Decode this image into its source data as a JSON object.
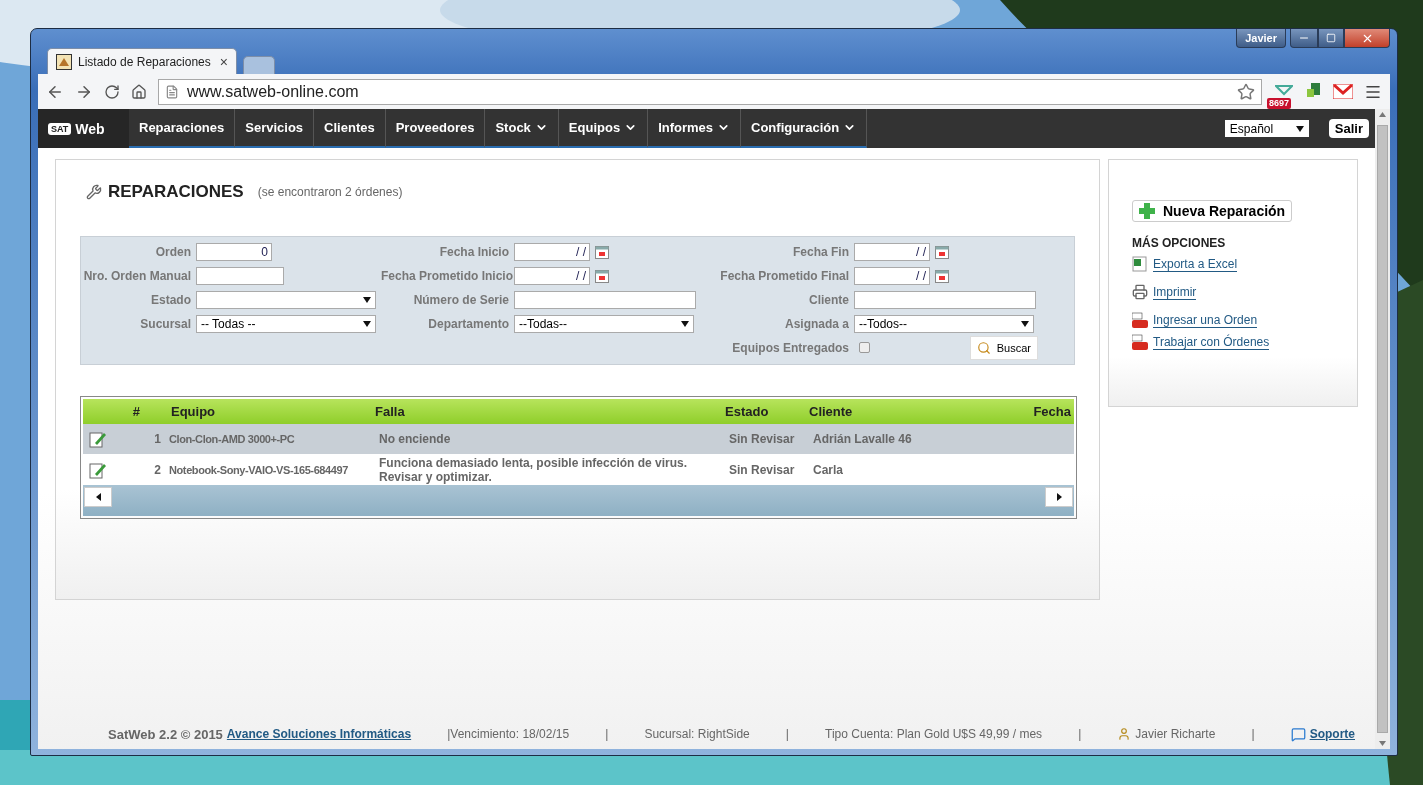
{
  "browser": {
    "tabs": [
      {
        "title": "Listado de Reparaciones",
        "close": "×",
        "selected": true
      },
      {
        "selected": false
      }
    ],
    "profile": "Javier",
    "url": "www.satweb-online.com",
    "extension_badge": "8697"
  },
  "nav": {
    "logo_badge": "SAT",
    "logo_text": "Web",
    "items": [
      {
        "label": "Reparaciones",
        "dropdown": false
      },
      {
        "label": "Servicios",
        "dropdown": false
      },
      {
        "label": "Clientes",
        "dropdown": false
      },
      {
        "label": "Proveedores",
        "dropdown": false
      },
      {
        "label": "Stock",
        "dropdown": true
      },
      {
        "label": "Equipos",
        "dropdown": true
      },
      {
        "label": "Informes",
        "dropdown": true
      },
      {
        "label": "Configuración",
        "dropdown": true
      }
    ],
    "language": "Español",
    "logout": "Salir"
  },
  "page": {
    "title": "REPARACIONES",
    "subtitle": "(se encontraron 2 órdenes)"
  },
  "filters": {
    "columns": [
      [
        {
          "label": "Orden",
          "kind": "number",
          "value": "0"
        },
        {
          "label": "Nro. Orden Manual",
          "kind": "short"
        },
        {
          "label": "Estado",
          "kind": "select"
        },
        {
          "label": "Sucursal",
          "kind": "select",
          "value": "-- Todas --"
        }
      ],
      [
        {
          "label": "Fecha Inicio",
          "kind": "date",
          "value": "/ /"
        },
        {
          "label": "Fecha Prometido Inicio",
          "kind": "date",
          "value": "/ /"
        },
        {
          "label": "Número de Serie",
          "kind": "text"
        },
        {
          "label": "Departamento",
          "kind": "select",
          "value": "--Todas--"
        }
      ],
      [
        {
          "label": "Fecha Fin",
          "kind": "date",
          "value": "/ /"
        },
        {
          "label": "Fecha Prometido Final",
          "kind": "date",
          "value": "/ /"
        },
        {
          "label": "Cliente",
          "kind": "text"
        },
        {
          "label": "Asignada a",
          "kind": "select",
          "value": "--Todos--"
        },
        {
          "label": "Equipos Entregados",
          "kind": "checkbox",
          "checked": false
        }
      ]
    ],
    "search_button": "Buscar"
  },
  "table": {
    "columns": [
      "#",
      "Equipo",
      "Falla",
      "Estado",
      "Cliente",
      "Fecha"
    ],
    "rows": [
      {
        "number": "1",
        "equipo": "Clon-Clon-AMD 3000+-PC",
        "falla": "No enciende",
        "estado": "Sin Revisar",
        "cliente": "Adrián Lavalle 46",
        "selected": true
      },
      {
        "number": "2",
        "equipo": "Notebook-Sony-VAIO-VS-165-684497",
        "falla": "Funciona demasiado lenta, posible infección de virus. Revisar y optimizar.",
        "estado": "Sin Revisar",
        "cliente": "Carla",
        "selected": false
      }
    ]
  },
  "sidebar": {
    "new_button": "Nueva Reparación",
    "options_title": "MÁS OPCIONES",
    "links": [
      {
        "label": "Exporta a Excel",
        "kind": "sheet"
      },
      {
        "label": "Imprimir",
        "kind": "printer"
      },
      {
        "label": "Ingresar una Orden",
        "kind": "video"
      },
      {
        "label": "Trabajar con Órdenes",
        "kind": "video"
      }
    ]
  },
  "footer": [
    {
      "kind": "brand",
      "text": "SatWeb 2.2 © 2015"
    },
    {
      "kind": "link",
      "text": "Avance Soluciones Informáticas"
    },
    {
      "kind": "text",
      "text": "|Vencimiento: 18/02/15"
    },
    {
      "kind": "separator",
      "text": "|"
    },
    {
      "kind": "text",
      "text": "Sucursal: RightSide"
    },
    {
      "kind": "separator",
      "text": "|"
    },
    {
      "kind": "text",
      "text": "Tipo Cuenta: Plan Gold U$S 49,99 / mes"
    },
    {
      "kind": "separator",
      "text": "|"
    },
    {
      "kind": "user",
      "text": "Javier Richarte"
    },
    {
      "kind": "separator",
      "text": "|"
    },
    {
      "kind": "support",
      "text": "Soporte"
    }
  ]
}
